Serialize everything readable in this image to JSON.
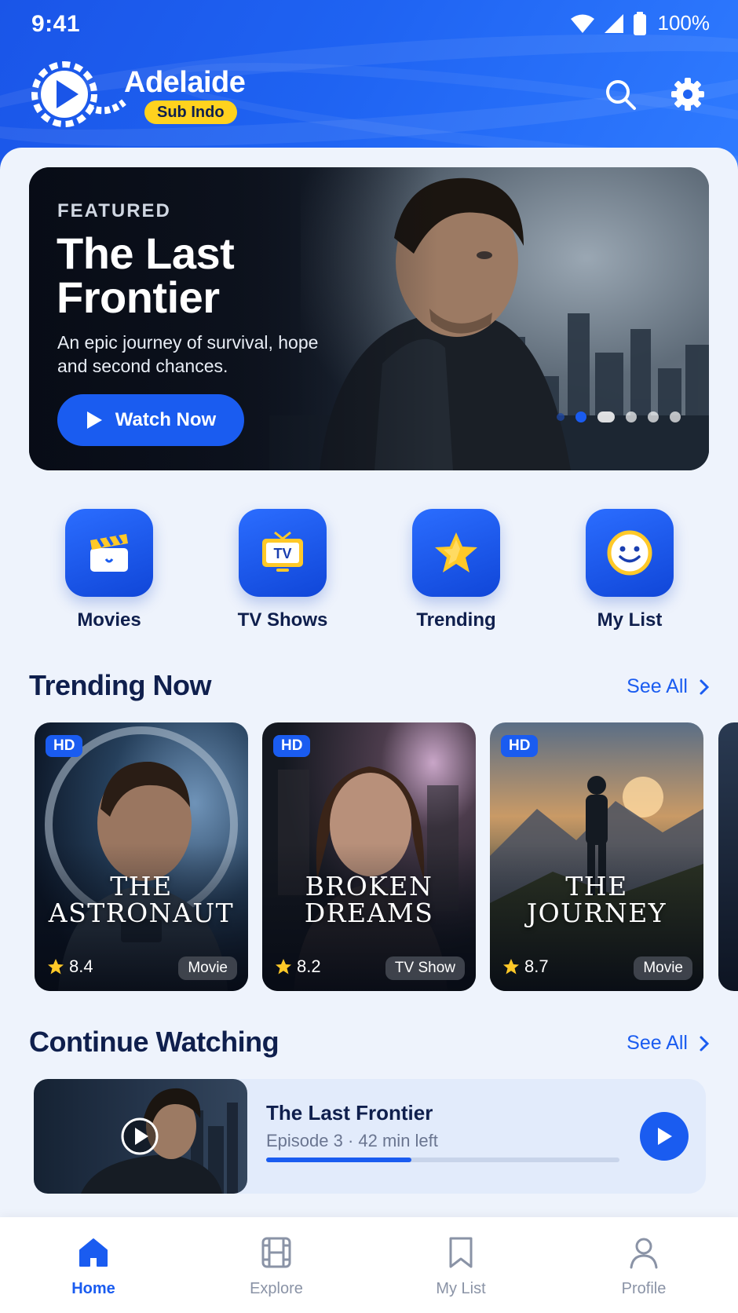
{
  "status_bar": {
    "time": "9:41",
    "battery": "100%"
  },
  "header": {
    "app_name": "Adelaide",
    "badge": "Sub Indo",
    "search_icon": "search-icon",
    "settings_icon": "gear-icon"
  },
  "hero": {
    "kicker": "FEATURED",
    "title": "The Last Frontier",
    "description": "An epic journey of survival, hope and second chances.",
    "cta_label": "Watch Now",
    "carousel_active_index": 1
  },
  "categories": [
    {
      "label": "Movies",
      "icon": "clapperboard-icon"
    },
    {
      "label": "TV Shows",
      "icon": "tv-icon"
    },
    {
      "label": "Trending",
      "icon": "star-icon"
    },
    {
      "label": "My List",
      "icon": "smiley-icon"
    }
  ],
  "trending": {
    "title": "Trending Now",
    "see_all": "See All",
    "items": [
      {
        "badge": "HD",
        "title_line1": "THE",
        "title_line2": "ASTRONAUT",
        "rating": "8.4",
        "type": "Movie"
      },
      {
        "badge": "HD",
        "title_line1": "BROKEN",
        "title_line2": "DREAMS",
        "rating": "8.2",
        "type": "TV Show"
      },
      {
        "badge": "HD",
        "title_line1": "THE",
        "title_line2": "JOURNEY",
        "rating": "8.7",
        "type": "Movie"
      }
    ]
  },
  "continue_watching": {
    "title": "Continue Watching",
    "see_all": "See All",
    "item": {
      "title": "The Last Frontier",
      "subtitle": "Episode 3 · 42 min left",
      "progress": 0.41
    }
  },
  "bottom_nav": [
    {
      "label": "Home",
      "icon": "home-icon",
      "active": true
    },
    {
      "label": "Explore",
      "icon": "film-icon",
      "active": false
    },
    {
      "label": "My List",
      "icon": "bookmark-icon",
      "active": false
    },
    {
      "label": "Profile",
      "icon": "profile-icon",
      "active": false
    }
  ],
  "colors": {
    "primary": "#1a5cf0",
    "accent": "#ffd21e",
    "text_dark": "#0f1f4d",
    "background": "#eef3fc"
  }
}
